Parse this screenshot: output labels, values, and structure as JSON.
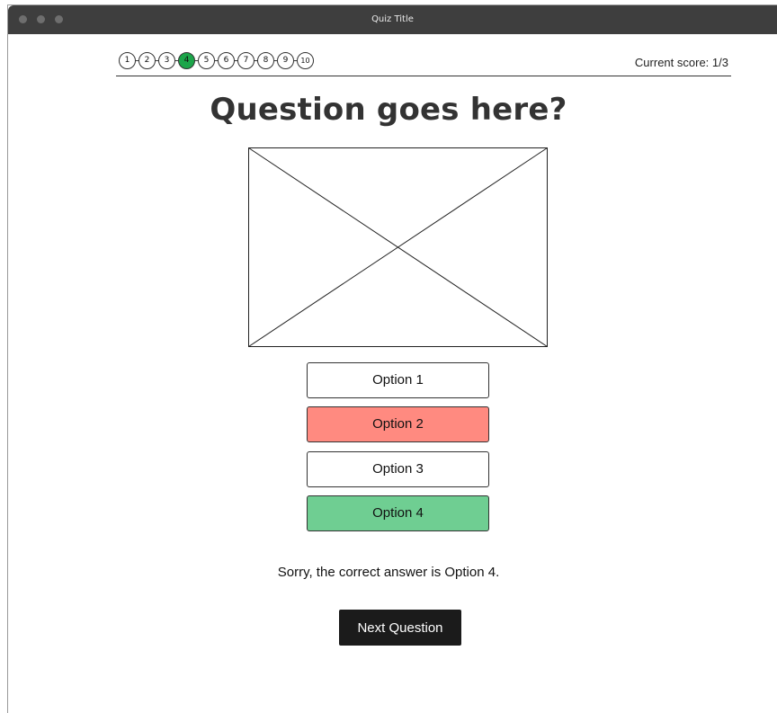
{
  "window": {
    "title": "Quiz Title"
  },
  "progress": {
    "steps": [
      "1",
      "2",
      "3",
      "4",
      "5",
      "6",
      "7",
      "8",
      "9",
      "10"
    ],
    "current": "4",
    "current_color": "#1ca54a"
  },
  "score": {
    "label": "Current score:",
    "value": "1/3"
  },
  "question": {
    "text": "Question goes here?"
  },
  "image": {
    "placeholder": "image-placeholder"
  },
  "options": [
    {
      "label": "Option 1",
      "state": "default"
    },
    {
      "label": "Option 2",
      "state": "wrong"
    },
    {
      "label": "Option 3",
      "state": "default"
    },
    {
      "label": "Option 4",
      "state": "correct"
    }
  ],
  "colors": {
    "wrong": "#ff8a80",
    "correct": "#6fce92",
    "button": "#1b1b1b"
  },
  "feedback": {
    "text": "Sorry, the correct answer is Option 4."
  },
  "next_button": {
    "label": "Next Question"
  }
}
